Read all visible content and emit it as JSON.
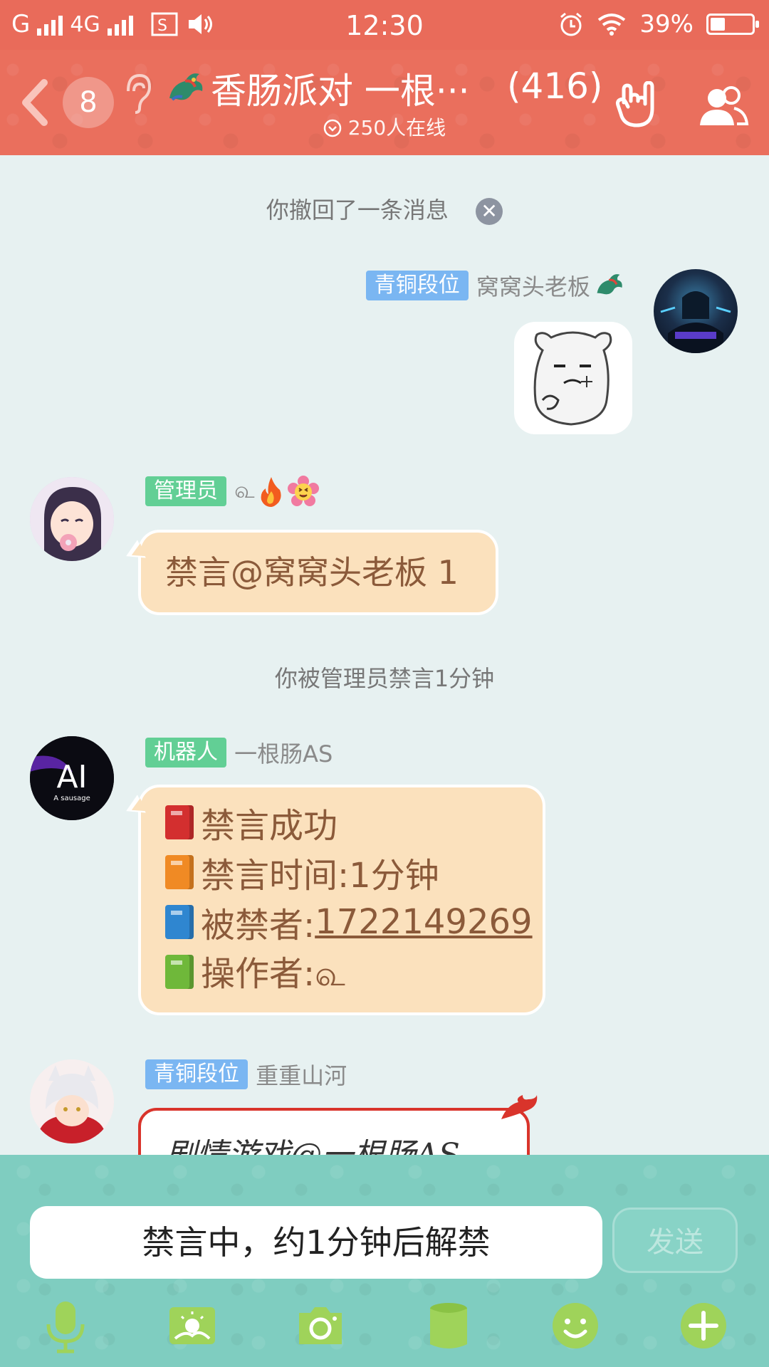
{
  "status_bar": {
    "carrier1": "G",
    "carrier2": "4G",
    "time": "12:30",
    "battery": "39%"
  },
  "header": {
    "unread_count": "8",
    "title": "香肠派对 一根···",
    "member_count": "(416)",
    "online": "250人在线"
  },
  "messages": {
    "recall_notice": "你撤回了一条消息",
    "recall_close": "✕",
    "msg1": {
      "rank": "青铜段位",
      "nick": "窝窝头老板"
    },
    "msg2": {
      "rank": "管理员",
      "nick": "௳",
      "text": "禁言@窝窝头老板 1"
    },
    "mute_notice": "你被管理员禁言1分钟",
    "msg3": {
      "rank": "机器人",
      "nick": "一根肠AS",
      "avatar_text": "AI",
      "avatar_sub": "A sausage",
      "lines": {
        "line1": "禁言成功",
        "line2": "禁言时间:1分钟",
        "line3_label": "被禁者:",
        "line3_value": "1722149269",
        "line4": "操作者:௳"
      }
    },
    "msg4": {
      "rank": "青铜段位",
      "nick": "重重山河",
      "text": "剧情游戏@一根肠AS"
    }
  },
  "input": {
    "muted_text": "禁言中，约1分钟后解禁",
    "send_label": "发送"
  },
  "colors": {
    "header_bg": "#ea6f5d",
    "chat_bg": "#e7f1f1",
    "bubble_bg": "#fbe1bd",
    "input_bg": "#7fcdc0",
    "rank_blue": "#7ab6f2",
    "rank_green": "#62cf95"
  },
  "toolbar_icons": [
    "microphone-icon",
    "picture-icon",
    "camera-icon",
    "cylinder-icon",
    "smiley-icon",
    "plus-icon"
  ]
}
